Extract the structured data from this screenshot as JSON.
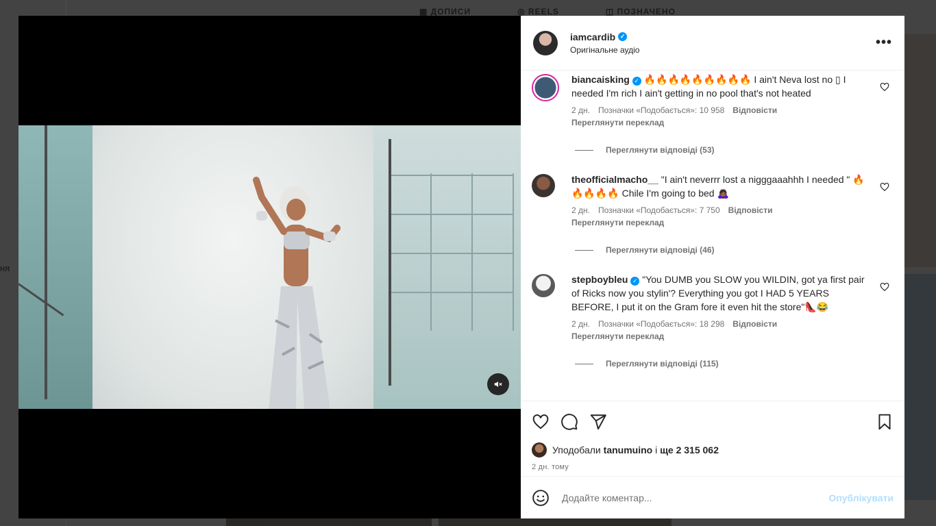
{
  "background": {
    "tabs": [
      "▦ ДОПИСИ",
      "◎ REELS",
      "◫ ПОЗНАЧЕНО"
    ],
    "side_text": "ня"
  },
  "post": {
    "username": "iamcardib",
    "audio": "Оригінальне аудіо",
    "more_label": "•••"
  },
  "comments": [
    {
      "username": "biancaisking",
      "verified": true,
      "text": "🔥🔥🔥🔥🔥🔥🔥🔥🔥 I ain't Neva lost no ▯ I needed I'm rich I ain't getting in no pool that's not heated",
      "time": "2 дн.",
      "likes": "Позначки «Подобається»: 10 958",
      "reply": "Відповісти",
      "translate": "Переглянути переклад",
      "view_replies": "Переглянути відповіді (53)"
    },
    {
      "username": "theofficialmacho__",
      "verified": false,
      "text": "\"I ain't neverrr lost a nigggaaahhh I needed \" 🔥🔥🔥🔥🔥 Chile I'm going to bed 🙇🏾‍♀️",
      "time": "2 дн.",
      "likes": "Позначки «Подобається»: 7 750",
      "reply": "Відповісти",
      "translate": "Переглянути переклад",
      "view_replies": "Переглянути відповіді (46)"
    },
    {
      "username": "stepboybleu",
      "verified": true,
      "text": "\"You DUMB you SLOW you WILDIN, got ya first pair of Ricks now you stylin'? Everything you got I HAD 5 YEARS BEFORE, I put it on the Gram fore it even hit the store\"👠😂",
      "time": "2 дн.",
      "likes": "Позначки «Подобається»: 18 298",
      "reply": "Відповісти",
      "translate": "Переглянути переклад",
      "view_replies": "Переглянути відповіді (115)"
    }
  ],
  "likes_summary": {
    "prefix": "Уподобали",
    "user": "tanumuino",
    "middle": "і",
    "rest": "ще 2 315 062"
  },
  "time_ago": "2 дн. тому",
  "add_comment": {
    "placeholder": "Додайте коментар...",
    "publish": "Опублікувати"
  },
  "colors": {
    "verified": "#0095f6",
    "publish_disabled": "#b2dffc",
    "secondary_text": "#737373"
  }
}
